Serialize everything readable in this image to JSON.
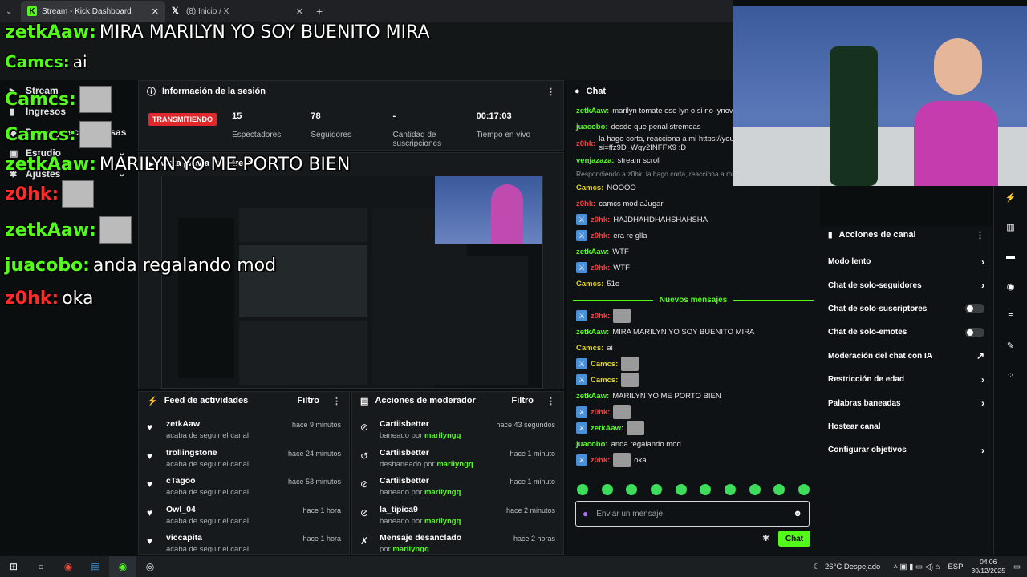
{
  "browser": {
    "tabs": [
      {
        "title": "Stream - Kick Dashboard",
        "favicon": "kick-icon",
        "active": true
      },
      {
        "title": "(8) Inicio / X",
        "favicon": "x-icon",
        "active": false
      }
    ],
    "new_tab": "+"
  },
  "overlay_chat": [
    {
      "user": "zetkAaw",
      "message": "MIRA MARILYN YO SOY BUENITO MIRA"
    },
    {
      "user": "Camcs",
      "message": "ai"
    },
    {
      "user": "Camcs",
      "message": ""
    },
    {
      "user": "Camcs",
      "message": ""
    },
    {
      "user": "zetkAaw",
      "message": "MARILYN YO ME PORTO BIEN"
    },
    {
      "user": "z0hk",
      "message": ""
    },
    {
      "user": "zetkAaw",
      "message": ""
    },
    {
      "user": "juacobo",
      "message": "anda regalando mod"
    },
    {
      "user": "z0hk",
      "message": "oka"
    }
  ],
  "sidebar": {
    "items": [
      {
        "label": "Stream",
        "icon": "play-icon"
      },
      {
        "label": "Ingresos",
        "icon": "chart-icon"
      },
      {
        "label": "Drops y recompensas",
        "icon": "gift-icon"
      },
      {
        "label": "Estudio",
        "icon": "studio-icon"
      },
      {
        "label": "Ajustes",
        "icon": "gear-icon"
      }
    ]
  },
  "session": {
    "title": "Información de la sesión",
    "status": "TRANSMITIENDO",
    "stats": [
      {
        "value": "15",
        "label": "Espectadores"
      },
      {
        "value": "78",
        "label": "Seguidores"
      },
      {
        "value": "-",
        "label": "Cantidad de suscripciones"
      },
      {
        "value": "00:17:03",
        "label": "Tiempo en vivo"
      }
    ]
  },
  "preview": {
    "title": "Vista previa del stream"
  },
  "activity": {
    "title": "Feed de actividades",
    "filter": "Filtro",
    "rows": [
      {
        "name": "zetkAaw",
        "sub": "acaba de seguir el canal",
        "time": "hace 9 minutos"
      },
      {
        "name": "trollingstone",
        "sub": "acaba de seguir el canal",
        "time": "hace 24 minutos"
      },
      {
        "name": "cTagoo",
        "sub": "acaba de seguir el canal",
        "time": "hace 53 minutos"
      },
      {
        "name": "Owl_04",
        "sub": "acaba de seguir el canal",
        "time": "hace 1 hora"
      },
      {
        "name": "viccapita",
        "sub": "acaba de seguir el canal",
        "time": "hace 1 hora"
      }
    ]
  },
  "modactions": {
    "title": "Acciones de moderador",
    "filter": "Filtro",
    "rows": [
      {
        "name": "Cartiisbetter",
        "action": "baneado por",
        "by": "marilyngq",
        "time": "hace 43 segundos"
      },
      {
        "name": "Cartiisbetter",
        "action": "desbaneado por",
        "by": "marilyngq",
        "time": "hace 1 minuto"
      },
      {
        "name": "Cartiisbetter",
        "action": "baneado por",
        "by": "marilyngq",
        "time": "hace 1 minuto"
      },
      {
        "name": "la_tipica9",
        "action": "baneado por",
        "by": "marilyngq",
        "time": "hace 2 minutos"
      },
      {
        "name": "Mensaje desanclado",
        "action": "por",
        "by": "marilyngq",
        "time": "hace 2 horas"
      }
    ]
  },
  "chat": {
    "title": "Chat",
    "messages": [
      {
        "user": "zetkAaw",
        "text": "marilyn tomate ese lyn o si no lynovin",
        "color": "green"
      },
      {
        "user": "juacobo",
        "text": "desde que penal stremeas",
        "color": "green"
      },
      {
        "user": "z0hk",
        "text": "la hago corta, reacciona a mi https://yout si=ffz9D_Wqy2INFFX9 :D",
        "color": "red"
      },
      {
        "user": "venjazaza",
        "text": "stream scroll",
        "color": "green"
      },
      {
        "user": "",
        "text": "Respondiendo a z0hk: la hago corta, reacciona a mi https://yout...",
        "color": "reply"
      },
      {
        "user": "Camcs",
        "text": "NOOOO",
        "color": "yellow"
      },
      {
        "user": "z0hk",
        "text": "camcs mod aJugar",
        "color": "red"
      },
      {
        "user": "z0hk",
        "text": "HAJDHAHDHAHSHAHSHA",
        "color": "red",
        "badge": true
      },
      {
        "user": "z0hk",
        "text": "era re glla",
        "color": "red",
        "badge": true
      },
      {
        "user": "zetkAaw",
        "text": "WTF",
        "color": "green"
      },
      {
        "user": "z0hk",
        "text": "WTF",
        "color": "red",
        "badge": true
      },
      {
        "user": "Camcs",
        "text": "51o",
        "color": "yellow"
      }
    ],
    "new_messages": "Nuevos mensajes",
    "new": [
      {
        "user": "z0hk",
        "text": "",
        "color": "red",
        "badge": true,
        "thumb": true
      },
      {
        "user": "zetkAaw",
        "text": "MIRA MARILYN YO SOY BUENITO MIRA",
        "color": "green"
      },
      {
        "user": "Camcs",
        "text": "ai",
        "color": "yellow"
      },
      {
        "user": "Camcs",
        "text": "",
        "color": "yellow",
        "badge": true,
        "thumb": true
      },
      {
        "user": "Camcs",
        "text": "",
        "color": "yellow",
        "badge": true,
        "thumb": true
      },
      {
        "user": "zetkAaw",
        "text": "MARILYN YO ME PORTO BIEN",
        "color": "green"
      },
      {
        "user": "z0hk",
        "text": "",
        "color": "red",
        "badge": true,
        "thumb": true
      },
      {
        "user": "zetkAaw",
        "text": "",
        "color": "green",
        "badge": true,
        "thumb": true
      },
      {
        "user": "juacobo",
        "text": "anda regalando mod",
        "color": "green"
      },
      {
        "user": "z0hk",
        "text": "oka",
        "color": "red",
        "badge": true,
        "thumb": true
      }
    ],
    "input_placeholder": "Enviar un mensaje",
    "send_label": "Chat"
  },
  "channel_actions": {
    "title": "Acciones de canal",
    "rows": [
      {
        "label": "Modo lento",
        "control": "chevron"
      },
      {
        "label": "Chat de solo-seguidores",
        "control": "chevron"
      },
      {
        "label": "Chat de solo-suscriptores",
        "control": "toggle"
      },
      {
        "label": "Chat de solo-emotes",
        "control": "toggle"
      },
      {
        "label": "Moderación del chat con IA",
        "control": "external"
      },
      {
        "label": "Restricción de edad",
        "control": "chevron"
      },
      {
        "label": "Palabras baneadas",
        "control": "chevron"
      },
      {
        "label": "Hostear canal",
        "control": "none"
      },
      {
        "label": "Configurar objetivos",
        "control": "chevron"
      }
    ]
  },
  "taskbar": {
    "weather": "26°C  Despejado",
    "lang": "ESP",
    "time": "04:06",
    "date": "30/12/2025"
  },
  "colors": {
    "kick_green": "#53fc18",
    "live_red": "#e0282c",
    "panel": "#171a1c"
  }
}
